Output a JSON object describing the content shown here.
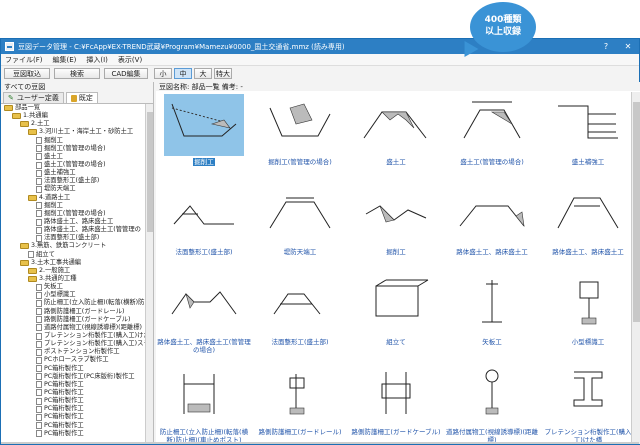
{
  "callout": {
    "line1": "400種類",
    "line2": "以上収録"
  },
  "window": {
    "title": "豆図データ管理 - C:¥FcApp¥EX-TREND武蔵¥Program¥Mamezu¥0000_国土交通省.mmz (読み専用)",
    "help": "?",
    "close": "✕"
  },
  "menu": [
    "ファイル(F)",
    "編集(E)",
    "挿入(I)",
    "表示(V)"
  ],
  "toolbar": {
    "import": "豆図取込",
    "search": "検索",
    "cad": "CAD編集",
    "sizes": [
      "小",
      "中",
      "大",
      "特大"
    ],
    "active_size": "中"
  },
  "left": {
    "label": "すべての豆図",
    "tabs": [
      "ユーザー定義",
      "既定"
    ],
    "tree": [
      {
        "depth": 0,
        "type": "folder",
        "text": "部品一覧"
      },
      {
        "depth": 1,
        "type": "folder",
        "text": "1.共通編"
      },
      {
        "depth": 2,
        "type": "folder",
        "text": "2.土工"
      },
      {
        "depth": 3,
        "type": "folder",
        "text": "3.河川土工・海岸土工・砂防土工"
      },
      {
        "depth": 4,
        "type": "doc",
        "text": "掘削工"
      },
      {
        "depth": 4,
        "type": "doc",
        "text": "掘削工(管管理の場合)"
      },
      {
        "depth": 4,
        "type": "doc",
        "text": "盛土工"
      },
      {
        "depth": 4,
        "type": "doc",
        "text": "盛土工(管管理の場合)"
      },
      {
        "depth": 4,
        "type": "doc",
        "text": "盛土補強工"
      },
      {
        "depth": 4,
        "type": "doc",
        "text": "法面整形工(盛土部)"
      },
      {
        "depth": 4,
        "type": "doc",
        "text": "堤防天端工"
      },
      {
        "depth": 3,
        "type": "folder",
        "text": "4.道路土工"
      },
      {
        "depth": 4,
        "type": "doc",
        "text": "掘削工"
      },
      {
        "depth": 4,
        "type": "doc",
        "text": "掘削工(管管理の場合)"
      },
      {
        "depth": 4,
        "type": "doc",
        "text": "路体盛土工、路床盛土工"
      },
      {
        "depth": 4,
        "type": "doc",
        "text": "路体盛土工、路床盛土工(管管理の"
      },
      {
        "depth": 4,
        "type": "doc",
        "text": "法面整形工(盛土部)"
      },
      {
        "depth": 2,
        "type": "folder",
        "text": "3.無筋、鉄筋コンクリート"
      },
      {
        "depth": 3,
        "type": "doc",
        "text": "組立て"
      },
      {
        "depth": 2,
        "type": "folder",
        "text": "3.土木工事共通編"
      },
      {
        "depth": 3,
        "type": "folder",
        "text": "2.一般施工"
      },
      {
        "depth": 3,
        "type": "folder",
        "text": "3.共通的工種"
      },
      {
        "depth": 4,
        "type": "doc",
        "text": "矢板工"
      },
      {
        "depth": 4,
        "type": "doc",
        "text": "小型標識工"
      },
      {
        "depth": 4,
        "type": "doc",
        "text": "防止柵工(立入防止柵)(転落(横断)防"
      },
      {
        "depth": 4,
        "type": "doc",
        "text": "路側防護柵工(ガードレール)"
      },
      {
        "depth": 4,
        "type": "doc",
        "text": "路側防護柵工(ガードケーブル)"
      },
      {
        "depth": 4,
        "type": "doc",
        "text": "道路付属物工(視線誘導標)(距離標)"
      },
      {
        "depth": 4,
        "type": "doc",
        "text": "プレテンション桁製作工(購入工)けた"
      },
      {
        "depth": 4,
        "type": "doc",
        "text": "プレテンション桁製作工(購入工)スラブ"
      },
      {
        "depth": 4,
        "type": "doc",
        "text": "ポストテンション桁製作工"
      },
      {
        "depth": 4,
        "type": "doc",
        "text": "PCホロースラブ製作工"
      },
      {
        "depth": 4,
        "type": "doc",
        "text": "PC箱桁製作工"
      },
      {
        "depth": 4,
        "type": "doc",
        "text": "PC版桁製作工(PC床版桁)製作工"
      },
      {
        "depth": 4,
        "type": "doc",
        "text": "PC箱桁製作工"
      },
      {
        "depth": 4,
        "type": "doc",
        "text": "PC箱桁製作工"
      },
      {
        "depth": 4,
        "type": "doc",
        "text": "PC箱桁製作工"
      },
      {
        "depth": 4,
        "type": "doc",
        "text": "PC箱桁製作工"
      },
      {
        "depth": 4,
        "type": "doc",
        "text": "PC箱桁製作工"
      },
      {
        "depth": 4,
        "type": "doc",
        "text": "PC箱桁製作工"
      },
      {
        "depth": 4,
        "type": "doc",
        "text": "PC箱桁製作工"
      }
    ]
  },
  "right": {
    "info": "豆図名称: 部品一覧  備考: -",
    "items": [
      {
        "label": "掘削工",
        "selected": true,
        "shape": "excavation"
      },
      {
        "label": "掘削工(管管理の場合)",
        "shape": "excavation2"
      },
      {
        "label": "盛土工",
        "shape": "embankment"
      },
      {
        "label": "盛土工(管管理の場合)",
        "shape": "embankment2"
      },
      {
        "label": "盛土補強工",
        "shape": "reinforce"
      },
      {
        "label": "法面整形工(盛土部)",
        "shape": "slope"
      },
      {
        "label": "堤防天端工",
        "shape": "crest"
      },
      {
        "label": "掘削工",
        "shape": "excavation3"
      },
      {
        "label": "路体盛土工、路床盛土工",
        "shape": "roadbed"
      },
      {
        "label": "路体盛土工、路床盛土工",
        "shape": "roadbed2"
      },
      {
        "label": "路体盛土工、路床盛土工(管管理の場合)",
        "shape": "roadbed3"
      },
      {
        "label": "法面整形工(盛土部)",
        "shape": "slope2"
      },
      {
        "label": "組立て",
        "shape": "assembly"
      },
      {
        "label": "矢板工",
        "shape": "sheetpile"
      },
      {
        "label": "小型標識工",
        "shape": "sign"
      },
      {
        "label": "防止柵工(立入防止柵)(転落(横断)防止柵)(車止めポスト)",
        "shape": "fence"
      },
      {
        "label": "路側防護柵工(ガードレール)",
        "shape": "guardrail"
      },
      {
        "label": "路側防護柵工(ガードケーブル)",
        "shape": "guardcable"
      },
      {
        "label": "道路付属物工(視線誘導標)(距離標)",
        "shape": "delineator"
      },
      {
        "label": "プレテンション桁製作工(購入工)けた橋",
        "shape": "girder"
      }
    ]
  }
}
